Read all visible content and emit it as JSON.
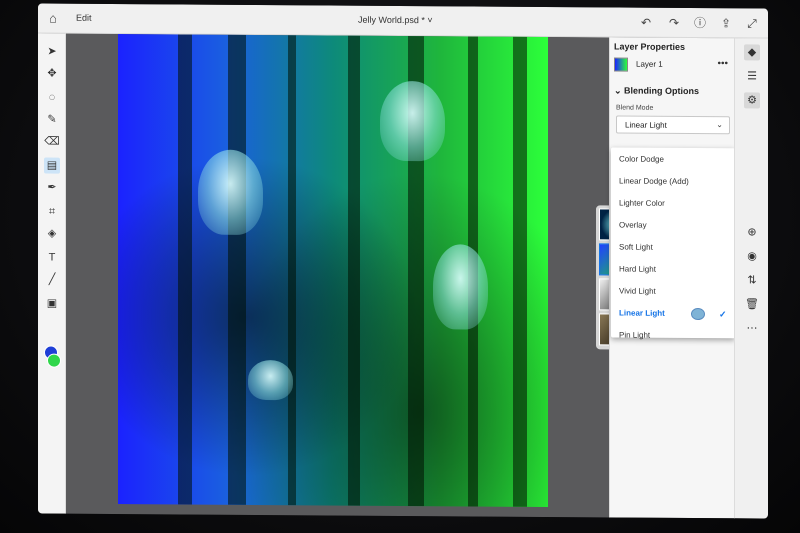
{
  "header": {
    "edit_label": "Edit",
    "document_title": "Jelly World.psd * ˅"
  },
  "panel": {
    "title": "Layer Properties",
    "layer_name": "Layer 1",
    "more_label": "•••",
    "blending_header": "Blending Options",
    "blend_mode_label": "Blend Mode",
    "blend_mode_value": "Linear Light"
  },
  "blend_menu": {
    "items": [
      "Color Dodge",
      "Linear Dodge (Add)",
      "Lighter Color",
      "Overlay",
      "Soft Light",
      "Hard Light",
      "Vivid Light",
      "Linear Light",
      "Pin Light"
    ],
    "selected": "Linear Light"
  },
  "colors": {
    "foreground": "#1f3fd6",
    "background": "#2fd64a",
    "accent": "#1473e6"
  },
  "icons": {
    "top": [
      "home-icon",
      "undo-icon",
      "redo-icon",
      "help-icon",
      "share-icon",
      "fullscreen-icon"
    ],
    "tools": [
      "move-icon",
      "transform-icon",
      "lasso-icon",
      "brush-icon",
      "eraser-icon",
      "gradient-icon",
      "eyedropper-icon",
      "crop-icon",
      "fill-icon",
      "type-icon",
      "line-icon",
      "image-icon"
    ],
    "rail": [
      "layers-icon",
      "layer-stack-icon",
      "properties-icon",
      "add-icon",
      "visibility-icon",
      "arrange-icon",
      "delete-icon",
      "more-icon"
    ]
  }
}
